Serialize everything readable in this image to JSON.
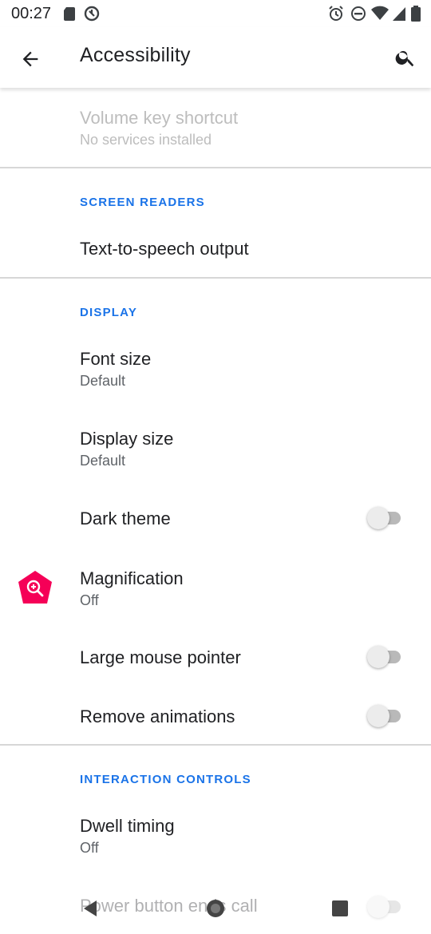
{
  "status_bar": {
    "time": "00:27",
    "left_icons": [
      "sd-card-icon",
      "no-data-icon"
    ],
    "right_icons": [
      "alarm-icon",
      "do-not-disturb-icon",
      "wifi-icon",
      "signal-icon",
      "battery-icon"
    ]
  },
  "app_bar": {
    "title": "Accessibility",
    "back_icon": "arrow-back-icon",
    "search_icon": "search-icon"
  },
  "items": {
    "volume_key": {
      "title": "Volume key shortcut",
      "summary": "No services installed",
      "enabled": false
    },
    "screen_readers_header": "SCREEN READERS",
    "tts": {
      "title": "Text-to-speech output"
    },
    "display_header": "DISPLAY",
    "font_size": {
      "title": "Font size",
      "summary": "Default"
    },
    "display_size": {
      "title": "Display size",
      "summary": "Default"
    },
    "dark_theme": {
      "title": "Dark theme",
      "checked": false
    },
    "magnification": {
      "title": "Magnification",
      "summary": "Off",
      "icon": "magnification-icon"
    },
    "large_mouse_pointer": {
      "title": "Large mouse pointer",
      "checked": false
    },
    "remove_animations": {
      "title": "Remove animations",
      "checked": false
    },
    "interaction_header": "INTERACTION CONTROLS",
    "dwell_timing": {
      "title": "Dwell timing",
      "summary": "Off"
    },
    "power_button": {
      "title": "Power button ends call",
      "checked": false
    }
  },
  "nav_bar": {
    "back": "nav-back-icon",
    "home": "nav-home-icon",
    "recents": "nav-recents-icon"
  },
  "colors": {
    "accent": "#1a73e8",
    "magnification_icon": "#f50057"
  }
}
